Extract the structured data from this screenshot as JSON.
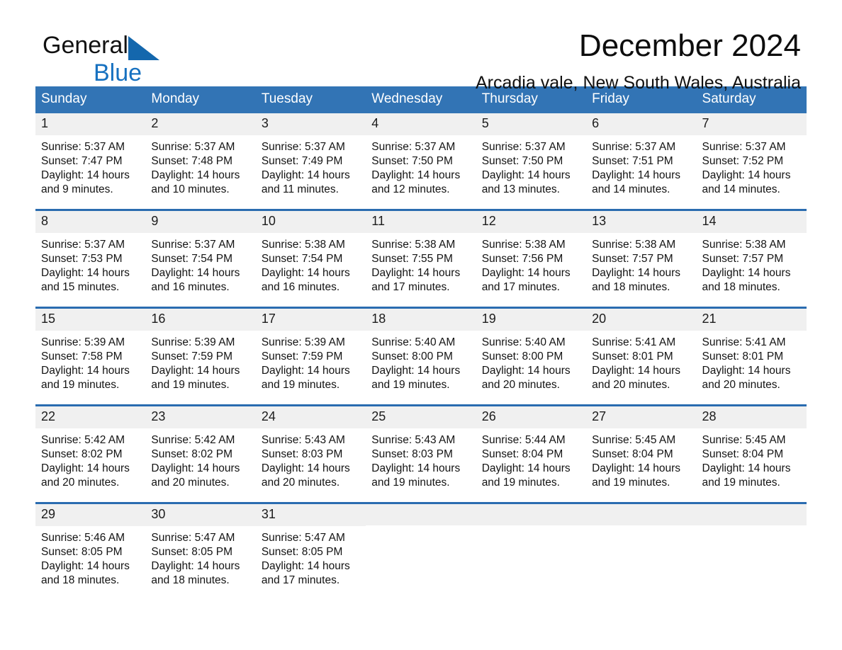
{
  "brand": {
    "word1": "General",
    "word2": "Blue",
    "triangle_color": "#1467ad",
    "blue_text_color": "#1771c0"
  },
  "header": {
    "month_title": "December 2024",
    "location": "Arcadia vale, New South Wales, Australia"
  },
  "theme": {
    "header_blue": "#3274b5",
    "row_divider_blue": "#2a6cb0",
    "daynum_band": "#f0f0f0",
    "page_background": "#ffffff"
  },
  "weekday_headers": [
    "Sunday",
    "Monday",
    "Tuesday",
    "Wednesday",
    "Thursday",
    "Friday",
    "Saturday"
  ],
  "weeks": [
    [
      {
        "day": "1",
        "sunrise": "Sunrise: 5:37 AM",
        "sunset": "Sunset: 7:47 PM",
        "daylight_line1": "Daylight: 14 hours",
        "daylight_line2": "and 9 minutes."
      },
      {
        "day": "2",
        "sunrise": "Sunrise: 5:37 AM",
        "sunset": "Sunset: 7:48 PM",
        "daylight_line1": "Daylight: 14 hours",
        "daylight_line2": "and 10 minutes."
      },
      {
        "day": "3",
        "sunrise": "Sunrise: 5:37 AM",
        "sunset": "Sunset: 7:49 PM",
        "daylight_line1": "Daylight: 14 hours",
        "daylight_line2": "and 11 minutes."
      },
      {
        "day": "4",
        "sunrise": "Sunrise: 5:37 AM",
        "sunset": "Sunset: 7:50 PM",
        "daylight_line1": "Daylight: 14 hours",
        "daylight_line2": "and 12 minutes."
      },
      {
        "day": "5",
        "sunrise": "Sunrise: 5:37 AM",
        "sunset": "Sunset: 7:50 PM",
        "daylight_line1": "Daylight: 14 hours",
        "daylight_line2": "and 13 minutes."
      },
      {
        "day": "6",
        "sunrise": "Sunrise: 5:37 AM",
        "sunset": "Sunset: 7:51 PM",
        "daylight_line1": "Daylight: 14 hours",
        "daylight_line2": "and 14 minutes."
      },
      {
        "day": "7",
        "sunrise": "Sunrise: 5:37 AM",
        "sunset": "Sunset: 7:52 PM",
        "daylight_line1": "Daylight: 14 hours",
        "daylight_line2": "and 14 minutes."
      }
    ],
    [
      {
        "day": "8",
        "sunrise": "Sunrise: 5:37 AM",
        "sunset": "Sunset: 7:53 PM",
        "daylight_line1": "Daylight: 14 hours",
        "daylight_line2": "and 15 minutes."
      },
      {
        "day": "9",
        "sunrise": "Sunrise: 5:37 AM",
        "sunset": "Sunset: 7:54 PM",
        "daylight_line1": "Daylight: 14 hours",
        "daylight_line2": "and 16 minutes."
      },
      {
        "day": "10",
        "sunrise": "Sunrise: 5:38 AM",
        "sunset": "Sunset: 7:54 PM",
        "daylight_line1": "Daylight: 14 hours",
        "daylight_line2": "and 16 minutes."
      },
      {
        "day": "11",
        "sunrise": "Sunrise: 5:38 AM",
        "sunset": "Sunset: 7:55 PM",
        "daylight_line1": "Daylight: 14 hours",
        "daylight_line2": "and 17 minutes."
      },
      {
        "day": "12",
        "sunrise": "Sunrise: 5:38 AM",
        "sunset": "Sunset: 7:56 PM",
        "daylight_line1": "Daylight: 14 hours",
        "daylight_line2": "and 17 minutes."
      },
      {
        "day": "13",
        "sunrise": "Sunrise: 5:38 AM",
        "sunset": "Sunset: 7:57 PM",
        "daylight_line1": "Daylight: 14 hours",
        "daylight_line2": "and 18 minutes."
      },
      {
        "day": "14",
        "sunrise": "Sunrise: 5:38 AM",
        "sunset": "Sunset: 7:57 PM",
        "daylight_line1": "Daylight: 14 hours",
        "daylight_line2": "and 18 minutes."
      }
    ],
    [
      {
        "day": "15",
        "sunrise": "Sunrise: 5:39 AM",
        "sunset": "Sunset: 7:58 PM",
        "daylight_line1": "Daylight: 14 hours",
        "daylight_line2": "and 19 minutes."
      },
      {
        "day": "16",
        "sunrise": "Sunrise: 5:39 AM",
        "sunset": "Sunset: 7:59 PM",
        "daylight_line1": "Daylight: 14 hours",
        "daylight_line2": "and 19 minutes."
      },
      {
        "day": "17",
        "sunrise": "Sunrise: 5:39 AM",
        "sunset": "Sunset: 7:59 PM",
        "daylight_line1": "Daylight: 14 hours",
        "daylight_line2": "and 19 minutes."
      },
      {
        "day": "18",
        "sunrise": "Sunrise: 5:40 AM",
        "sunset": "Sunset: 8:00 PM",
        "daylight_line1": "Daylight: 14 hours",
        "daylight_line2": "and 19 minutes."
      },
      {
        "day": "19",
        "sunrise": "Sunrise: 5:40 AM",
        "sunset": "Sunset: 8:00 PM",
        "daylight_line1": "Daylight: 14 hours",
        "daylight_line2": "and 20 minutes."
      },
      {
        "day": "20",
        "sunrise": "Sunrise: 5:41 AM",
        "sunset": "Sunset: 8:01 PM",
        "daylight_line1": "Daylight: 14 hours",
        "daylight_line2": "and 20 minutes."
      },
      {
        "day": "21",
        "sunrise": "Sunrise: 5:41 AM",
        "sunset": "Sunset: 8:01 PM",
        "daylight_line1": "Daylight: 14 hours",
        "daylight_line2": "and 20 minutes."
      }
    ],
    [
      {
        "day": "22",
        "sunrise": "Sunrise: 5:42 AM",
        "sunset": "Sunset: 8:02 PM",
        "daylight_line1": "Daylight: 14 hours",
        "daylight_line2": "and 20 minutes."
      },
      {
        "day": "23",
        "sunrise": "Sunrise: 5:42 AM",
        "sunset": "Sunset: 8:02 PM",
        "daylight_line1": "Daylight: 14 hours",
        "daylight_line2": "and 20 minutes."
      },
      {
        "day": "24",
        "sunrise": "Sunrise: 5:43 AM",
        "sunset": "Sunset: 8:03 PM",
        "daylight_line1": "Daylight: 14 hours",
        "daylight_line2": "and 20 minutes."
      },
      {
        "day": "25",
        "sunrise": "Sunrise: 5:43 AM",
        "sunset": "Sunset: 8:03 PM",
        "daylight_line1": "Daylight: 14 hours",
        "daylight_line2": "and 19 minutes."
      },
      {
        "day": "26",
        "sunrise": "Sunrise: 5:44 AM",
        "sunset": "Sunset: 8:04 PM",
        "daylight_line1": "Daylight: 14 hours",
        "daylight_line2": "and 19 minutes."
      },
      {
        "day": "27",
        "sunrise": "Sunrise: 5:45 AM",
        "sunset": "Sunset: 8:04 PM",
        "daylight_line1": "Daylight: 14 hours",
        "daylight_line2": "and 19 minutes."
      },
      {
        "day": "28",
        "sunrise": "Sunrise: 5:45 AM",
        "sunset": "Sunset: 8:04 PM",
        "daylight_line1": "Daylight: 14 hours",
        "daylight_line2": "and 19 minutes."
      }
    ],
    [
      {
        "day": "29",
        "sunrise": "Sunrise: 5:46 AM",
        "sunset": "Sunset: 8:05 PM",
        "daylight_line1": "Daylight: 14 hours",
        "daylight_line2": "and 18 minutes."
      },
      {
        "day": "30",
        "sunrise": "Sunrise: 5:47 AM",
        "sunset": "Sunset: 8:05 PM",
        "daylight_line1": "Daylight: 14 hours",
        "daylight_line2": "and 18 minutes."
      },
      {
        "day": "31",
        "sunrise": "Sunrise: 5:47 AM",
        "sunset": "Sunset: 8:05 PM",
        "daylight_line1": "Daylight: 14 hours",
        "daylight_line2": "and 17 minutes."
      },
      {
        "day": "",
        "sunrise": "",
        "sunset": "",
        "daylight_line1": "",
        "daylight_line2": ""
      },
      {
        "day": "",
        "sunrise": "",
        "sunset": "",
        "daylight_line1": "",
        "daylight_line2": ""
      },
      {
        "day": "",
        "sunrise": "",
        "sunset": "",
        "daylight_line1": "",
        "daylight_line2": ""
      },
      {
        "day": "",
        "sunrise": "",
        "sunset": "",
        "daylight_line1": "",
        "daylight_line2": ""
      }
    ]
  ]
}
